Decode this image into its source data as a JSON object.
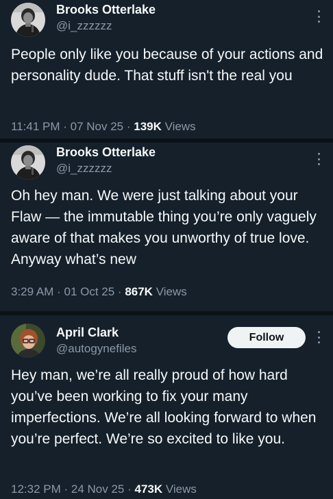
{
  "tweets": [
    {
      "author_name": "Brooks Otterlake",
      "handle": "@i_zzzzzz",
      "text": "People only like you because of your actions and personality dude. That stuff isn't the real you",
      "time": "11:41 PM",
      "date": "07 Nov 25",
      "views_count": "139K",
      "views_label": "Views"
    },
    {
      "author_name": "Brooks Otterlake",
      "handle": "@i_zzzzzz",
      "text": "Oh hey man. We were just talking about your Flaw — the immutable thing you’re only vaguely aware of that makes you unworthy of true love. Anyway what’s new",
      "time": "3:29 AM",
      "date": "01 Oct 25",
      "views_count": "867K",
      "views_label": "Views"
    },
    {
      "author_name": "April Clark",
      "handle": "@autogynefiles",
      "follow_label": "Follow",
      "text": "Hey man, we’re all really proud of how hard you’ve been working to fix your many imperfections. We’re all looking forward to when you’re perfect. We’re so excited to like you.",
      "time": "12:32 PM",
      "date": "24 Nov 25",
      "views_count": "473K",
      "views_label": "Views"
    }
  ],
  "separator": " · ",
  "colors": {
    "background": "#15202b",
    "text_primary": "#f7f9f9",
    "text_secondary": "#8b98a5",
    "follow_button_bg": "#eff3f4",
    "follow_button_text": "#0f1419"
  },
  "icons": {
    "more": "more-vertical-icon"
  }
}
